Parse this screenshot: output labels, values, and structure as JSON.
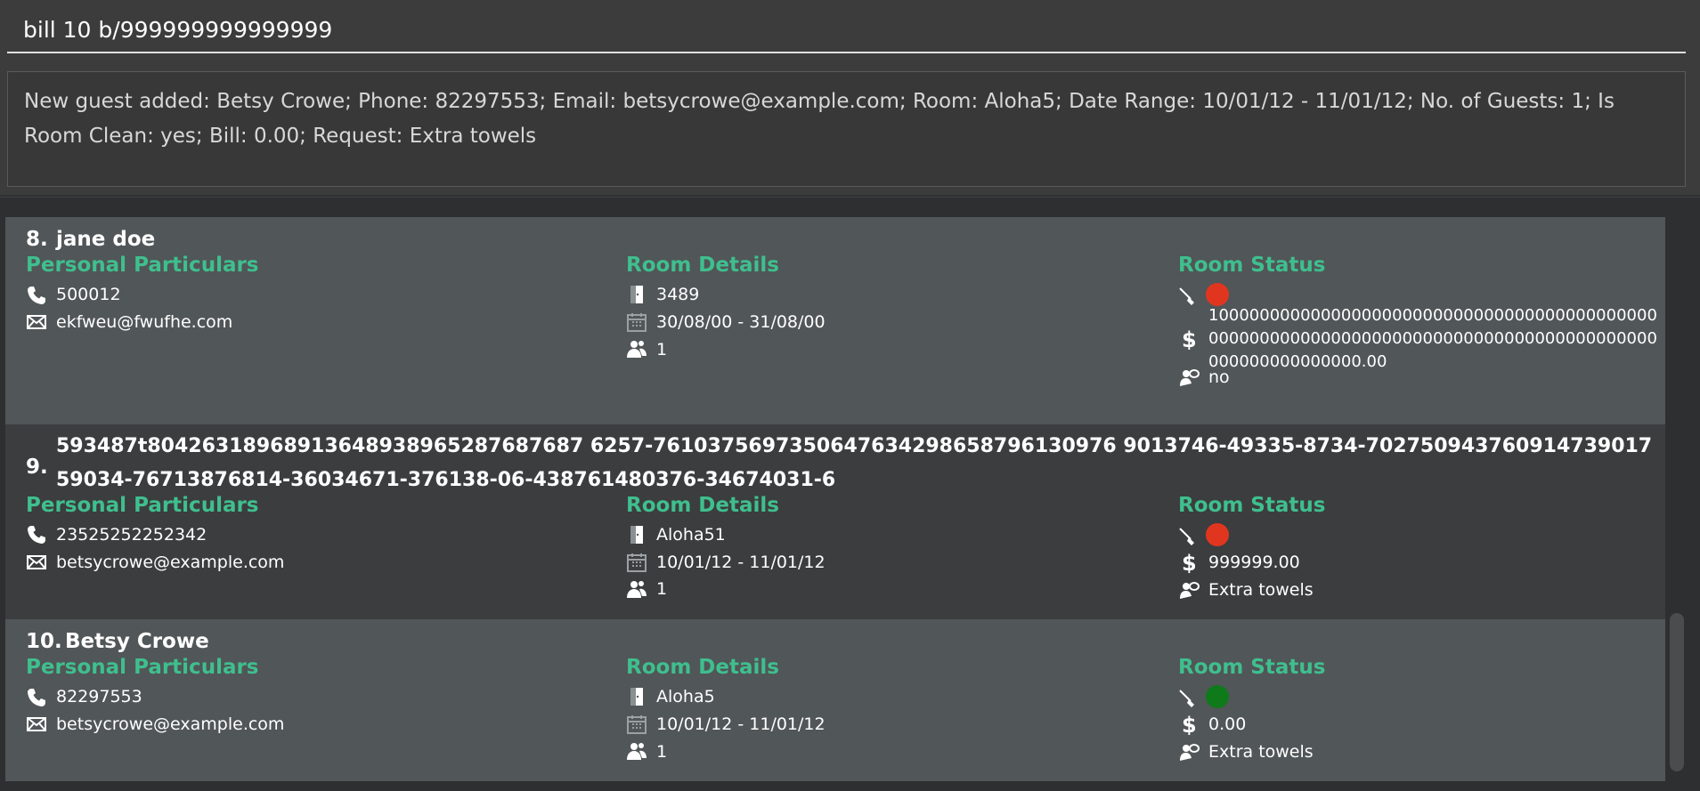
{
  "command": {
    "value": "bill 10 b/999999999999999"
  },
  "result": {
    "text": "New guest added: Betsy Crowe; Phone: 82297553; Email: betsycrowe@example.com; Room: Aloha5; Date Range: 10/01/12 - 11/01/12; No. of Guests: 1; Is Room Clean: yes; Bill: 0.00; Request: Extra towels"
  },
  "sections": {
    "personal": "Personal Particulars",
    "room": "Room Details",
    "status": "Room Status"
  },
  "guests": [
    {
      "index": "8.",
      "name": "jane doe",
      "phone": "500012",
      "email": "ekfweu@fwufhe.com",
      "room": "3489",
      "dates": "30/08/00 - 31/08/00",
      "guests": "1",
      "clean_color": "#e0361f",
      "bill": "1000000000000000000000000000000000000000000000000000000000000000000000000000000000000000000000000000000.00",
      "request": "no"
    },
    {
      "index": "9.",
      "name": "593487t80426318968913648938965287687687 6257-7610375697350647634298658796130976 9013746-49335-8734-702750943760914739017 59034-76713876814-36034671-376138-06-438761480376-34674031-6",
      "phone": "23525252252342",
      "email": "betsycrowe@example.com",
      "room": "Aloha51",
      "dates": "10/01/12 - 11/01/12",
      "guests": "1",
      "clean_color": "#e0361f",
      "bill": "999999.00",
      "request": "Extra towels"
    },
    {
      "index": "10.",
      "name": "Betsy Crowe",
      "phone": "82297553",
      "email": "betsycrowe@example.com",
      "room": "Aloha5",
      "dates": "10/01/12 - 11/01/12",
      "guests": "1",
      "clean_color": "#0f7a1a",
      "bill": "0.00",
      "request": "Extra towels"
    }
  ],
  "icons": {
    "phone": "phone-icon",
    "email": "envelope-icon",
    "room": "door-icon",
    "dates": "calendar-icon",
    "guests": "people-icon",
    "clean": "broom-icon",
    "bill": "dollar-icon",
    "request": "concierge-icon"
  },
  "colors": {
    "accent": "#3fbf8e",
    "clean_no": "#e0361f",
    "clean_yes": "#0f7a1a"
  }
}
